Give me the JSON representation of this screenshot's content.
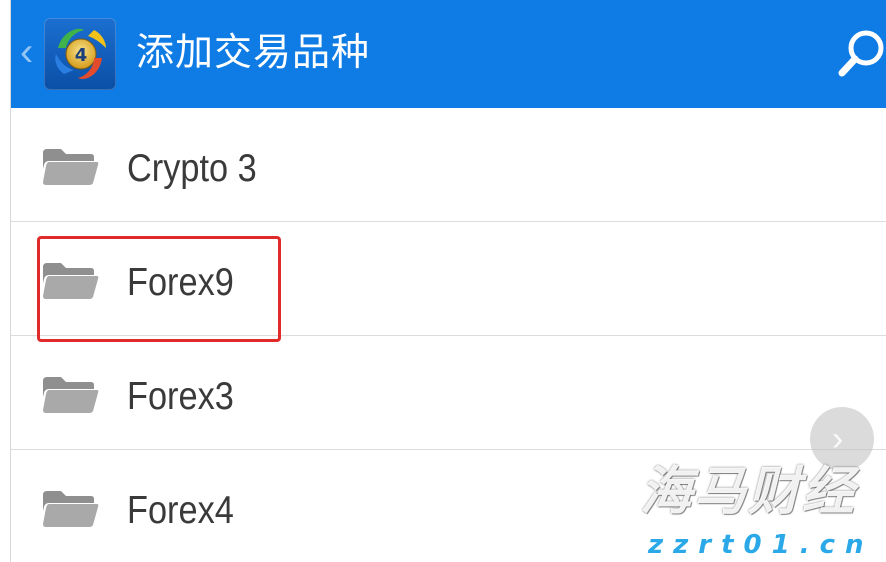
{
  "app_bar": {
    "title": "添加交易品种",
    "back_icon": "chevron-left-icon",
    "logo_icon": "metatrader-4-logo",
    "search_icon": "search-icon",
    "background_color": "#0f7ce6"
  },
  "list": {
    "items": [
      {
        "label": "Crypto 3",
        "icon": "folder-icon"
      },
      {
        "label": "Forex9",
        "icon": "folder-icon",
        "highlighted": true
      },
      {
        "label": "Forex3",
        "icon": "folder-icon"
      },
      {
        "label": "Forex4",
        "icon": "folder-icon"
      }
    ]
  },
  "highlight": {
    "color": "#e02b2b"
  },
  "scroll_button": {
    "icon": "chevron-right-icon"
  },
  "watermark": {
    "title": "海马财经",
    "url": "zzrt01.cn",
    "url_color": "#2aa8e8"
  }
}
